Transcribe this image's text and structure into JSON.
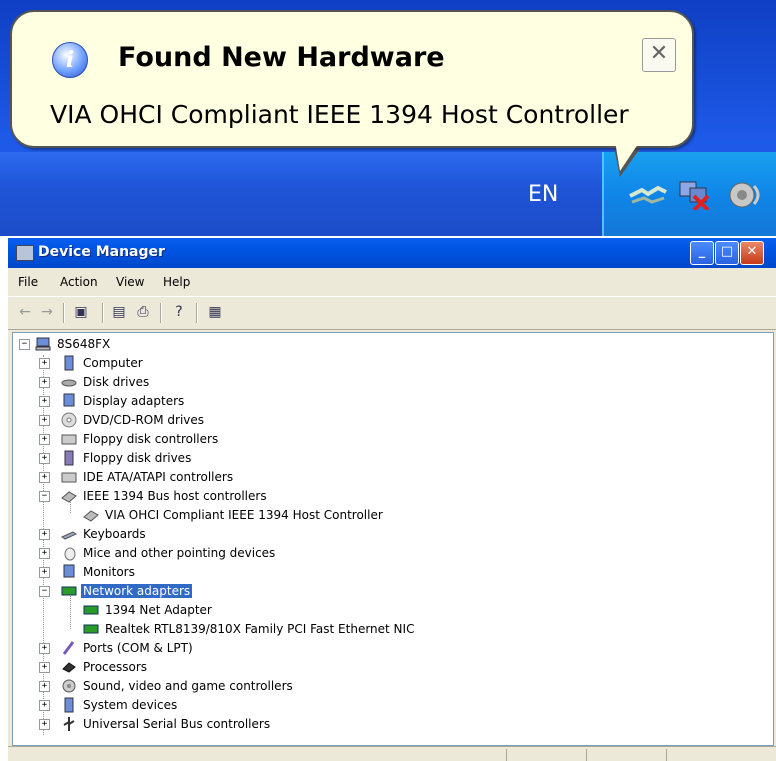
{
  "notification": {
    "title": "Found New Hardware",
    "message": "VIA OHCI Compliant IEEE 1394 Host Controller",
    "close_glyph": "✕"
  },
  "taskbar": {
    "language": "EN",
    "tray_icons": [
      "network-connection-icon",
      "network-disconnected-icon",
      "volume-icon"
    ]
  },
  "window": {
    "title": "Device Manager",
    "title_color": "#0054e3",
    "menu": [
      "File",
      "Action",
      "View",
      "Help"
    ],
    "toolbar_icons": [
      "back-icon",
      "forward-icon",
      "show-hide-console-tree-icon",
      "properties-icon",
      "print-icon",
      "help-icon",
      "scan-hardware-icon"
    ]
  },
  "tree": {
    "root": "8S648FX",
    "items": [
      {
        "label": "Computer",
        "icon": "computer-icon",
        "expanded": false
      },
      {
        "label": "Disk drives",
        "icon": "disk-drive-icon",
        "expanded": false
      },
      {
        "label": "Display adapters",
        "icon": "display-adapter-icon",
        "expanded": false
      },
      {
        "label": "DVD/CD-ROM drives",
        "icon": "cdrom-icon",
        "expanded": false
      },
      {
        "label": "Floppy disk controllers",
        "icon": "floppy-controller-icon",
        "expanded": false
      },
      {
        "label": "Floppy disk drives",
        "icon": "floppy-drive-icon",
        "expanded": false
      },
      {
        "label": "IDE ATA/ATAPI controllers",
        "icon": "ide-controller-icon",
        "expanded": false
      },
      {
        "label": "IEEE 1394 Bus host controllers",
        "icon": "ieee1394-icon",
        "expanded": true
      },
      {
        "label": "VIA OHCI Compliant IEEE 1394 Host Controller",
        "icon": "ieee1394-device-icon",
        "child": true
      },
      {
        "label": "Keyboards",
        "icon": "keyboard-icon",
        "expanded": false
      },
      {
        "label": "Mice and other pointing devices",
        "icon": "mouse-icon",
        "expanded": false
      },
      {
        "label": "Monitors",
        "icon": "monitor-icon",
        "expanded": false
      },
      {
        "label": "Network adapters",
        "icon": "network-adapter-icon",
        "expanded": true,
        "selected": true
      },
      {
        "label": "1394 Net Adapter",
        "icon": "network-card-icon",
        "child": true
      },
      {
        "label": "Realtek RTL8139/810X Family PCI Fast Ethernet NIC",
        "icon": "network-card-icon",
        "child": true
      },
      {
        "label": "Ports (COM & LPT)",
        "icon": "port-icon",
        "expanded": false
      },
      {
        "label": "Processors",
        "icon": "processor-icon",
        "expanded": false
      },
      {
        "label": "Sound, video and game controllers",
        "icon": "sound-icon",
        "expanded": false
      },
      {
        "label": "System devices",
        "icon": "system-device-icon",
        "expanded": false
      },
      {
        "label": "Universal Serial Bus controllers",
        "icon": "usb-icon",
        "expanded": false
      }
    ]
  }
}
